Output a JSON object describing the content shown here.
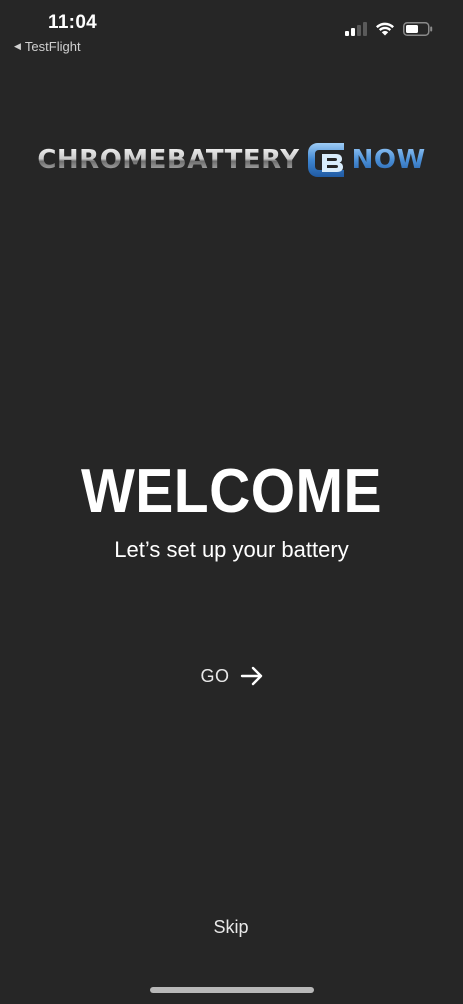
{
  "status_bar": {
    "time": "11:04",
    "back_app_label": "TestFlight",
    "back_arrow_glyph": "◀",
    "icons": [
      "signal-icon",
      "wifi-icon",
      "battery-icon"
    ]
  },
  "logo": {
    "part1": "CHROMEBATTERY",
    "part2": "NOW",
    "mark_icon": "cb-logo-icon",
    "colors": {
      "chrome": "#c9c9c9",
      "now_blue": "#4a8fd6"
    }
  },
  "welcome": {
    "title": "WELCOME",
    "subtitle": "Let’s set up your battery"
  },
  "go_button": {
    "label": "GO",
    "icon": "arrow-right-icon"
  },
  "skip_button": {
    "label": "Skip"
  },
  "colors": {
    "background": "#262626",
    "text": "#ffffff",
    "muted_text": "#e8e8e8"
  }
}
